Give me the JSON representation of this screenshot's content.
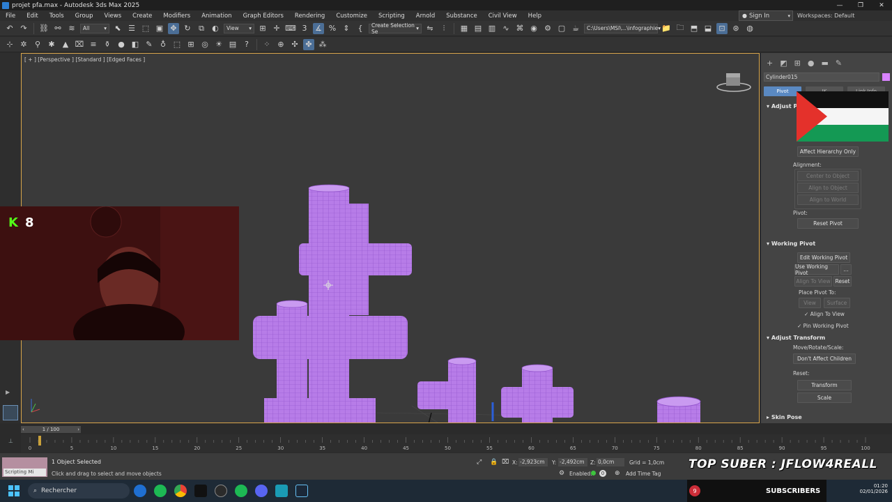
{
  "window": {
    "title": "projet pfa.max - Autodesk 3ds Max 2025",
    "controls": [
      "—",
      "❐",
      "✕"
    ]
  },
  "menu": [
    "File",
    "Edit",
    "Tools",
    "Group",
    "Views",
    "Create",
    "Modifiers",
    "Animation",
    "Graph Editors",
    "Rendering",
    "Customize",
    "Scripting",
    "Arnold",
    "Substance",
    "Civil View",
    "Help"
  ],
  "signin": "Sign In",
  "workspace": "Workspaces: Default",
  "toolbar": {
    "selection_filter": "All",
    "ref_coord": "View",
    "named_selection": "Create Selection Se",
    "project_path": "C:\\Users\\MSI\\...\\infographie"
  },
  "viewport": {
    "label": "[ + ] [Perspective ] [Standard ] [Edged Faces ]",
    "object_color": "#b77ce8"
  },
  "command_panel": {
    "object_name": "Cylinder015",
    "object_color": "#d883ff",
    "tabs": [
      "Pivot",
      "IK",
      "Link Info"
    ],
    "adjust_pivot": {
      "title": "Adjust Pi",
      "affect_hierarchy": "Affect Hierarchy Only",
      "alignment_label": "Alignment:",
      "center_to_object": "Center to Object",
      "align_to_object": "Align to Object",
      "align_to_world": "Align to World",
      "pivot_label": "Pivot:",
      "reset_pivot": "Reset Pivot"
    },
    "working_pivot": {
      "title": "Working Pivot",
      "edit": "Edit Working Pivot",
      "use": "Use Working Pivot",
      "more": "...",
      "align_to_view": "Align To View",
      "reset": "Reset",
      "place_pivot_to": "Place Pivot To:",
      "view": "View",
      "surface": "Surface",
      "align_to_view_check": "Align To View",
      "pin_working_pivot": "Pin Working Pivot"
    },
    "adjust_transform": {
      "title": "Adjust Transform",
      "move_rotate_scale": "Move/Rotate/Scale:",
      "dont_affect_children": "Don't Affect Children",
      "reset_label": "Reset:",
      "transform": "Transform",
      "scale": "Scale"
    },
    "skin_pose": "Skin Pose"
  },
  "webcam": {
    "badge_letter": "K",
    "badge_count": "8",
    "badge_color": "#53fc18"
  },
  "timeline": {
    "frame_indicator": "1 / 100",
    "ticks": [
      "0",
      "5",
      "10",
      "15",
      "20",
      "25",
      "30",
      "35",
      "40",
      "45",
      "50",
      "55",
      "60",
      "65",
      "70",
      "75",
      "80",
      "85",
      "90",
      "95",
      "100"
    ]
  },
  "status": {
    "maxscript": "Scripting Mi",
    "selected": "1 Object Selected",
    "prompt": "Click and drag to select and move objects",
    "x_label": "X:",
    "x_value": "-2,923cm",
    "y_label": "Y:",
    "y_value": "-2,492cm",
    "z_label": "Z:",
    "z_value": "0,0cm",
    "grid": "Grid = 1,0cm",
    "enabled": "Enabled:",
    "enabled_value": "0",
    "add_time_tag": "Add Time Tag",
    "overlay_text": "TOP SUBER : JFLOW4REALL"
  },
  "taskbar": {
    "search": "Rechercher",
    "subs_count": "9",
    "subs_label": "SUBSCRIBERS",
    "time": "01:20",
    "date": "02/01/2026"
  }
}
